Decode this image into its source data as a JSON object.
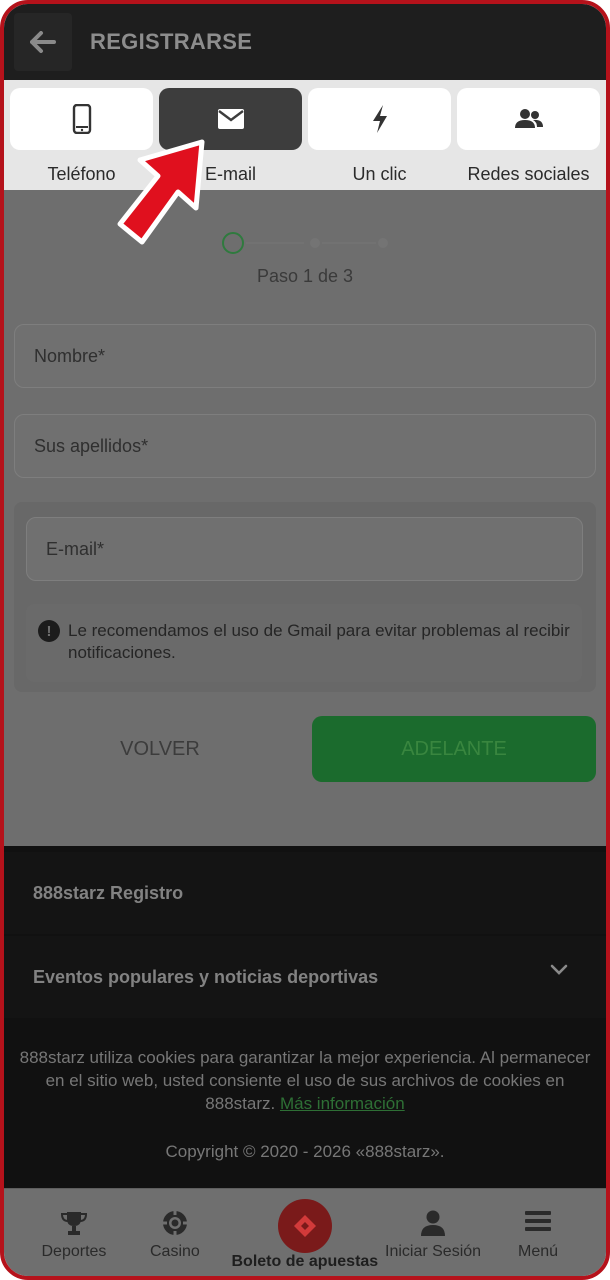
{
  "header": {
    "title": "REGISTRARSE",
    "back_icon": "arrow-left-icon"
  },
  "tabs": [
    {
      "label": "Teléfono",
      "icon": "phone-icon",
      "active": false
    },
    {
      "label": "E-mail",
      "icon": "envelope-icon",
      "active": true
    },
    {
      "label": "Un clic",
      "icon": "lightning-icon",
      "active": false
    },
    {
      "label": "Redes sociales",
      "icon": "users-icon",
      "active": false
    }
  ],
  "form": {
    "step_text": "Paso 1 de 3",
    "name_placeholder": "Nombre*",
    "surname_placeholder": "Sus apellidos*",
    "email_placeholder": "E-mail*",
    "notice": "Le recomendamos el uso de Gmail para evitar problemas al recibir notificaciones.",
    "back_label": "VOLVER",
    "next_label": "ADELANTE"
  },
  "footer": {
    "registro": "888starz Registro",
    "eventos": "Eventos populares y noticias deportivas",
    "cookie_text": "888starz utiliza cookies para garantizar la mejor experiencia. Al permanecer en el sitio web, usted consiente el uso de sus archivos de cookies en 888starz.",
    "more_link": "Más información",
    "copyright": "Copyright © 2020 - 2026 «888starz»."
  },
  "bottom_nav": {
    "deportes": "Deportes",
    "casino": "Casino",
    "boleto": "Boleto de apuestas",
    "iniciar": "Iniciar Sesión",
    "menu": "Menú"
  },
  "colors": {
    "accent_red": "#b5121b",
    "accent_green": "#1b6b2d",
    "arrow_red": "#e0101e"
  }
}
